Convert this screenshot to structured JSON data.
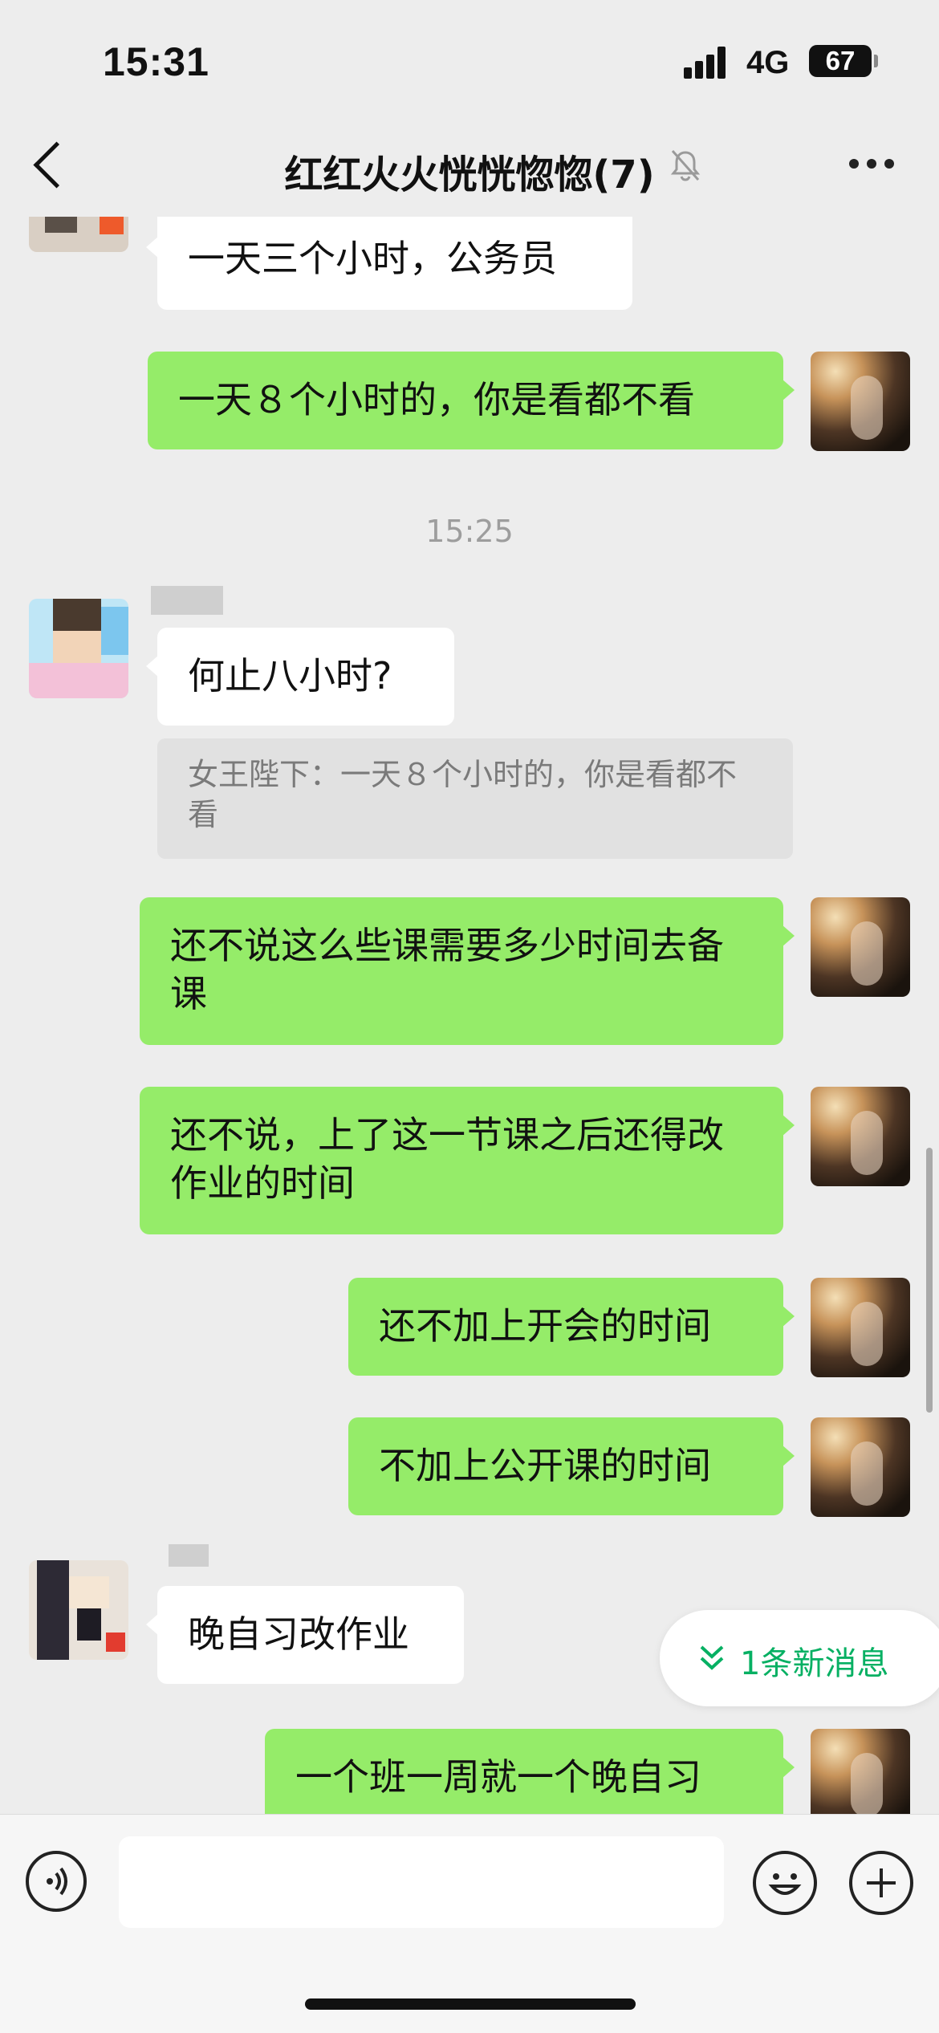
{
  "status": {
    "time": "15:31",
    "network": "4G",
    "battery": "67"
  },
  "header": {
    "title": "红红火火恍恍惚惚(7)"
  },
  "messages": {
    "m1": "一天三个小时，公务员",
    "m2": "一天８个小时的，你是看都不看",
    "timestamp": "15:25",
    "m3": "何止八小时?",
    "m3_quote": "女王陛下：一天８个小时的，你是看都不看",
    "m4": "还不说这么些课需要多少时间去备课",
    "m5": "还不说，上了这一节课之后还得改作业的时间",
    "m6": "还不加上开会的时间",
    "m7": "不加上公开课的时间",
    "m8": "晚自习改作业",
    "m9": "一个班一周就一个晚自习"
  },
  "new_messages": {
    "label": "1条新消息"
  },
  "colors": {
    "bubble_out": "#95ec69",
    "bubble_in": "#ffffff",
    "background": "#ededed",
    "accent": "#07b063"
  },
  "icons": {
    "back": "chevron-left-icon",
    "mute": "bell-muted-icon",
    "more": "ellipsis-icon",
    "voice": "voice-icon",
    "emoji": "emoji-icon",
    "plus": "plus-icon",
    "new_messages": "double-chevron-down-icon"
  }
}
